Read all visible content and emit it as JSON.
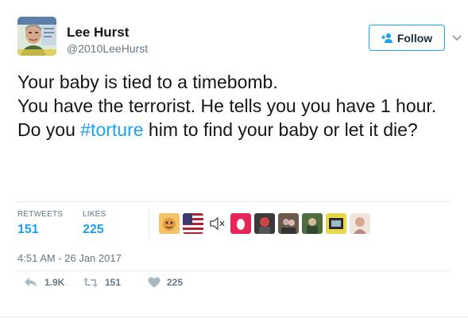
{
  "author": {
    "name": "Lee Hurst",
    "handle": "@2010LeeHurst"
  },
  "follow_button": {
    "label": "Follow"
  },
  "tweet": {
    "lines": [
      "Your baby is tied to a timebomb.",
      "You have the terrorist. He tells you you have 1 hour.",
      "Do you ",
      "#torture",
      " him to find your baby or let it die?"
    ]
  },
  "stats": {
    "retweets_label": "RETWEETS",
    "retweets_value": "151",
    "likes_label": "LIKES",
    "likes_value": "225"
  },
  "timestamp": "4:51 AM - 26 Jan 2017",
  "actions": {
    "reply_count": "1.9K",
    "retweet_count": "151",
    "like_count": "225"
  },
  "colors": {
    "accent": "#1da1f2",
    "secondary_text": "#657786",
    "primary_text": "#14171a",
    "divider": "#e6ecf0"
  },
  "icons": {
    "follow": "add-user-icon",
    "menu": "chevron-down-icon",
    "reply": "reply-icon",
    "retweet": "retweet-icon",
    "like": "heart-icon"
  }
}
